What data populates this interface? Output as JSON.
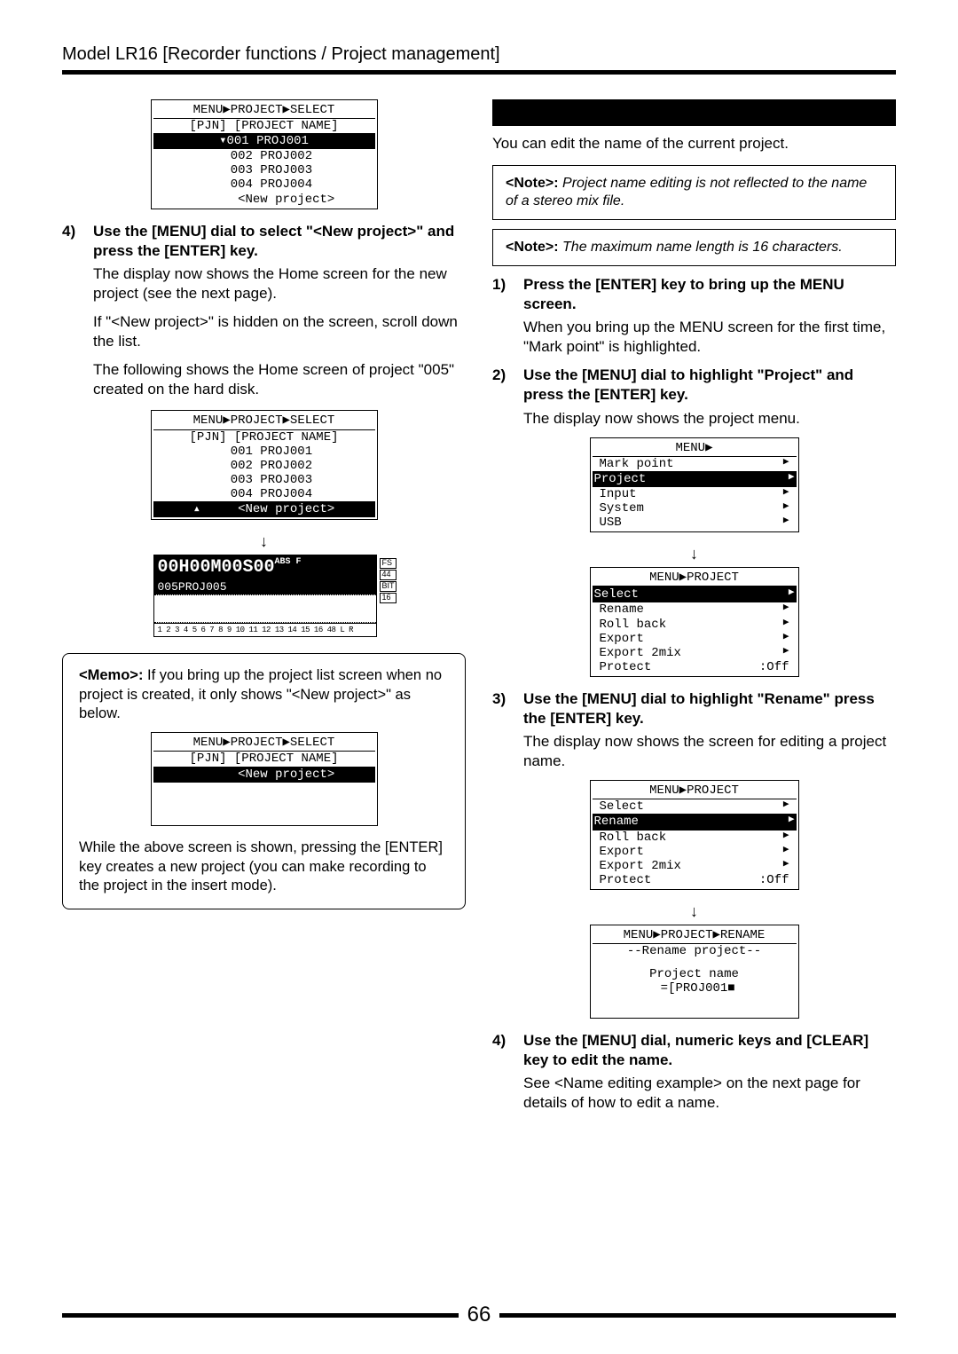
{
  "header": "Model LR16 [Recorder functions / Project management]",
  "page_number": "66",
  "left": {
    "screen1": {
      "breadcrumb": "MENU▶PROJECT▶SELECT",
      "cols": "[PJN] [PROJECT NAME]",
      "rows": [
        "▾001 PROJ001",
        "  002 PROJ002",
        "  003 PROJ003",
        "  004 PROJ004",
        "      <New project>"
      ]
    },
    "step4_num": "4)",
    "step4_bold": "Use the [MENU] dial to select \"<New project>\" and press the [ENTER] key.",
    "step4_body": "The display now shows the Home screen for the new project (see the next page).",
    "para1": "If \"<New project>\" is hidden on the screen, scroll down the list.",
    "para2": "The following shows the Home screen of project \"005\" created on the hard disk.",
    "screen2": {
      "breadcrumb": "MENU▶PROJECT▶SELECT",
      "cols": "[PJN] [PROJECT NAME]",
      "rows": [
        "  001 PROJ001",
        "  002 PROJ002",
        "  003 PROJ003",
        "  004 PROJ004",
        "▴     <New project>"
      ]
    },
    "home": {
      "time": "00H00M00S00",
      "abs": "ABS F",
      "name": "005PROJ005",
      "side": [
        "FS",
        "44",
        "BIT",
        "16"
      ],
      "tracks": "1 2 3 4 5 6 7 8 9 10 11 12 13 14 15 16 48 L R"
    },
    "memo_label": "<Memo>:",
    "memo_text": " If you bring up the project list screen when no project is created, it only shows \"<New project>\" as below.",
    "memo_screen": {
      "breadcrumb": "MENU▶PROJECT▶SELECT",
      "cols": "[PJN] [PROJECT NAME]",
      "rows": [
        "      <New project>",
        " ",
        " ",
        " "
      ]
    },
    "memo_text2": "While the above screen is shown, pressing the [ENTER] key creates a new project (you can make recording to the project in the insert mode)."
  },
  "right": {
    "intro": "You can edit the name of the current project.",
    "note1_label": "<Note>:",
    "note1_text": "  Project name editing is not reflected to the name of a stereo mix file.",
    "note2_label": "<Note>:",
    "note2_text": " The maximum name length is 16 characters.",
    "step1_num": "1)",
    "step1_bold": "Press the [ENTER] key to bring up the MENU screen.",
    "step1_body": "When you bring up the MENU screen for the first time, \"Mark point\" is highlighted.",
    "step2_num": "2)",
    "step2_bold": "Use the [MENU] dial to highlight \"Project\" and press the [ENTER] key.",
    "step2_body": "The display now shows the project menu.",
    "menu1": {
      "breadcrumb": "MENU▶",
      "items": [
        "Mark point",
        "Project",
        "Input",
        "System",
        "USB"
      ],
      "highlighted": 1
    },
    "menu2": {
      "breadcrumb": "MENU▶PROJECT",
      "items": [
        {
          "label": "Select",
          "val": "▶"
        },
        {
          "label": "Rename",
          "val": "▶"
        },
        {
          "label": "Roll back",
          "val": "▶"
        },
        {
          "label": "Export",
          "val": "▶"
        },
        {
          "label": "Export 2mix",
          "val": "▶"
        },
        {
          "label": "Protect",
          "val": ":Off"
        }
      ],
      "highlighted": 0
    },
    "step3_num": "3)",
    "step3_bold": "Use the [MENU] dial to highlight \"Rename\" press the [ENTER] key.",
    "step3_body": "The display now shows the screen for editing a project name.",
    "menu3": {
      "breadcrumb": "MENU▶PROJECT",
      "items": [
        {
          "label": "Select",
          "val": "▶"
        },
        {
          "label": "Rename",
          "val": "▶"
        },
        {
          "label": "Roll back",
          "val": "▶"
        },
        {
          "label": "Export",
          "val": "▶"
        },
        {
          "label": "Export 2mix",
          "val": "▶"
        },
        {
          "label": "Protect",
          "val": ":Off"
        }
      ],
      "highlighted": 1
    },
    "rename_screen": {
      "breadcrumb": "MENU▶PROJECT▶RENAME",
      "line1": "--Rename project--",
      "line2": "Project name",
      "line3": " =[PROJ001■"
    },
    "step4_num": "4)",
    "step4_bold": "Use the [MENU] dial, numeric keys and [CLEAR] key to edit the name.",
    "step4_body": "See <Name editing example> on the next page for details of how to edit a name."
  }
}
